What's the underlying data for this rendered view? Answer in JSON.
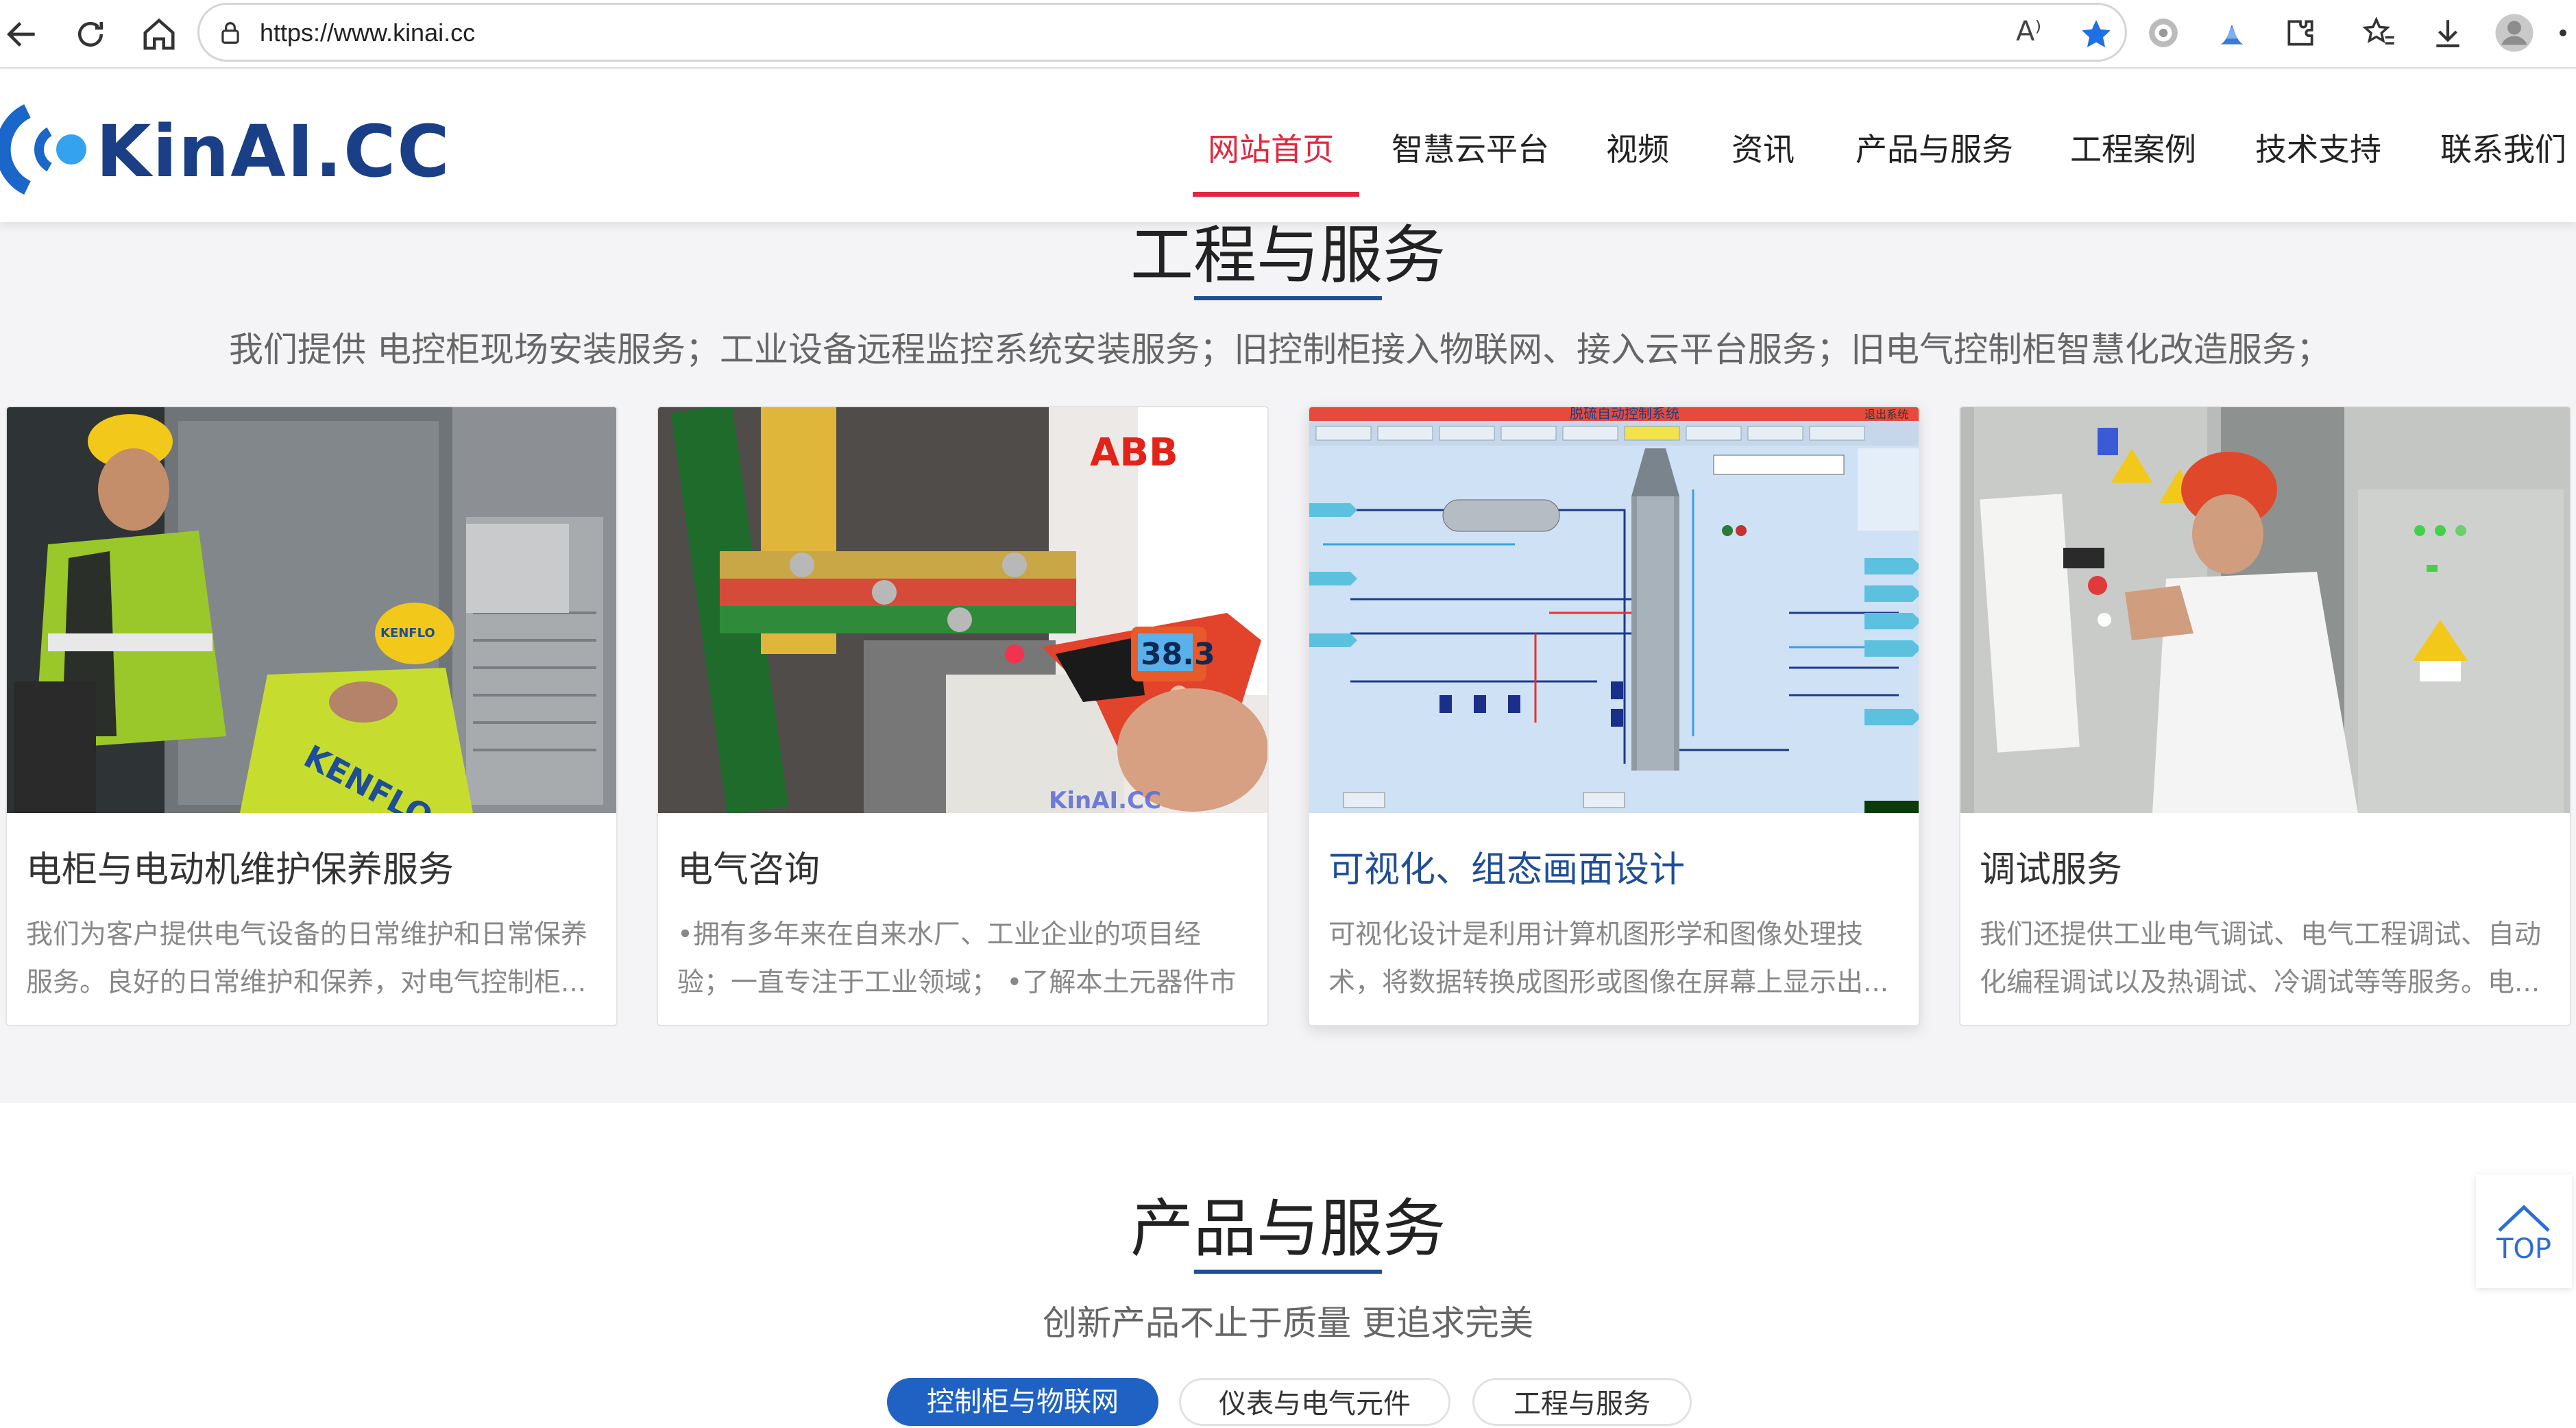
{
  "browser": {
    "url": "https://www.kinai.cc",
    "read_aloud_label": "A⁾"
  },
  "site": {
    "logo_text": "KinAI.CC",
    "menu": [
      "网站首页",
      "智慧云平台",
      "视频",
      "资讯",
      "产品与服务",
      "工程案例",
      "技术支持",
      "联系我们"
    ],
    "active_menu": "网站首页"
  },
  "engineering": {
    "title": "工程与服务",
    "subtitle": "我们提供 电控柜现场安装服务；工业设备远程监控系统安装服务；旧控制柜接入物联网、接入云平台服务；旧电气控制柜智慧化改造服务；",
    "cards": [
      {
        "title": "电柜与电动机维护保养服务",
        "desc": "我们为客户提供电气设备的日常维护和日常保养服务。良好的日常维护和保养，对电气控制柜...",
        "image_alt": "workers-maintaining-cabinet",
        "worker_vest_text": "KENFLO",
        "worker_helmet_text": "KENFLO"
      },
      {
        "title": "电气咨询",
        "desc": "•拥有多年来在自来水厂、工业企业的项目经验；一直专注于工业领域；  •了解本土元器件市场，...",
        "image_alt": "infrared-thermometer-measuring",
        "brand": "ABB",
        "reading": "38.3",
        "watermark": "KinAI.CC"
      },
      {
        "title": "可视化、组态画面设计",
        "desc": "可视化设计是利用计算机图形学和图像处理技术，将数据转换成图形或图像在屏幕上显示出...",
        "image_alt": "scada-diagram",
        "scada_title": "脱硫自动控制系统",
        "scada_exit": "退出系统"
      },
      {
        "title": "调试服务",
        "desc": "我们还提供工业电气调试、电气工程调试、自动化编程调试以及热调试、冷调试等等服务。电...",
        "image_alt": "engineer-debugging-cabinet"
      }
    ]
  },
  "products": {
    "title": "产品与服务",
    "subtitle": "创新产品不止于质量 更追求完美",
    "tabs": [
      "控制柜与物联网",
      "仪表与电气元件",
      "工程与服务"
    ],
    "active_tab": "控制柜与物联网"
  },
  "top_button": "TOP",
  "colors": {
    "accent_red": "#e0283f",
    "brand_blue": "#1f4e96",
    "logo_blue": "#1a3f86",
    "bg_gray": "#f4f4f6"
  }
}
